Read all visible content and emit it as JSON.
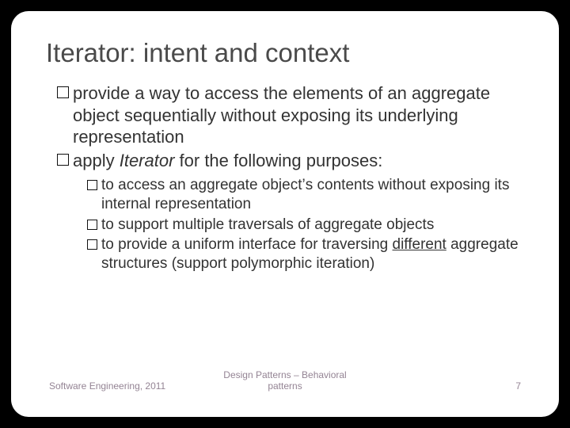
{
  "slide": {
    "title": "Iterator: intent and context",
    "bullets_lvl1": [
      {
        "pre": "provide a way to access the elements of an aggregate object sequentially without exposing its underlying representation"
      },
      {
        "pre": "apply ",
        "italic": "Iterator",
        "post": " for the following purposes:"
      }
    ],
    "bullets_lvl2": [
      {
        "pre": "to access an aggregate object",
        "apos": "’",
        "post": "s contents without exposing its internal representation"
      },
      {
        "pre": "to support multiple traversals of aggregate objects"
      },
      {
        "pre": "to provide a uniform interface for traversing ",
        "underline": "different",
        "post": " aggregate structures (support polymorphic iteration)"
      }
    ],
    "footer": {
      "left": "Software Engineering, 2011",
      "center": "Design Patterns – Behavioral patterns",
      "right": "7"
    }
  }
}
